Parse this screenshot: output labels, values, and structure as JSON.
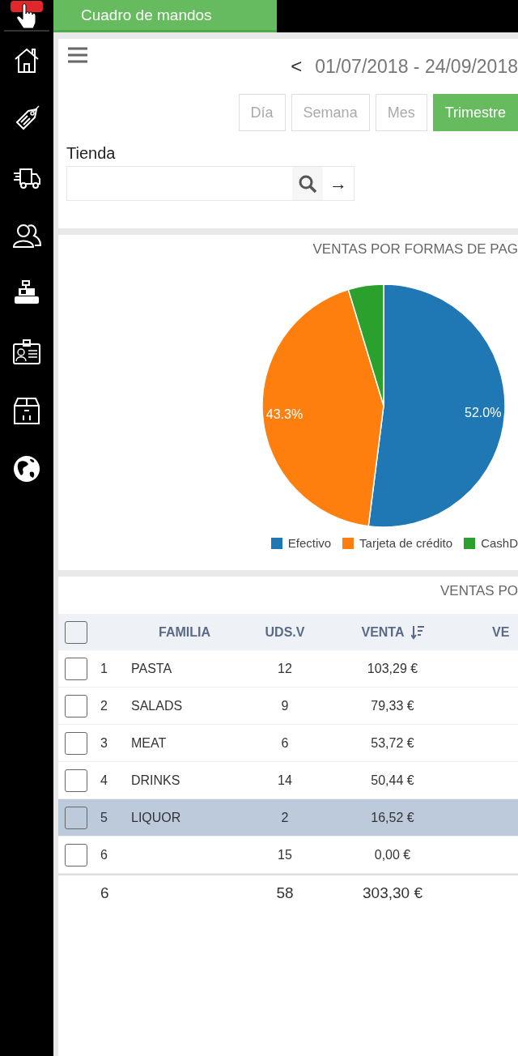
{
  "top_tab": {
    "label": "Cuadro de mandos",
    "selected": true
  },
  "filters": {
    "prev": "<",
    "date_range": "01/07/2018 - 24/09/2018",
    "periods": [
      {
        "label": "Día",
        "selected": false
      },
      {
        "label": "Semana",
        "selected": false
      },
      {
        "label": "Mes",
        "selected": false
      },
      {
        "label": "Trimestre",
        "selected": true
      }
    ],
    "store_label": "Tienda",
    "go": "→"
  },
  "payment_chart": {
    "title": "VENTAS POR FORMAS DE PAG",
    "chart_data": {
      "type": "pie",
      "categories": [
        "Efectivo",
        "Tarjeta de crédito",
        "CashD"
      ],
      "values": [
        52.0,
        43.3,
        4.7
      ],
      "colors": [
        "#1f77b4",
        "#ff7f0e",
        "#2ca02c"
      ],
      "value_labels": [
        "52.0%",
        "43.3%",
        null
      ]
    }
  },
  "family_table": {
    "title": "VENTAS PO",
    "columns": [
      "FAMILIA",
      "UDS.V",
      "VENTA",
      "VE"
    ],
    "header_checked": false,
    "rows": [
      {
        "index": "1",
        "familia": "PASTA",
        "uds": "12",
        "venta": "103,29 €",
        "checked": false,
        "selected": false
      },
      {
        "index": "2",
        "familia": "SALADS",
        "uds": "9",
        "venta": "79,33 €",
        "checked": false,
        "selected": false
      },
      {
        "index": "3",
        "familia": "MEAT",
        "uds": "6",
        "venta": "53,72 €",
        "checked": false,
        "selected": false
      },
      {
        "index": "4",
        "familia": "DRINKS",
        "uds": "14",
        "venta": "50,44 €",
        "checked": false,
        "selected": false
      },
      {
        "index": "5",
        "familia": "LIQUOR",
        "uds": "2",
        "venta": "16,52 €",
        "checked": false,
        "selected": true
      },
      {
        "index": "6",
        "uds": "15",
        "venta": "0,00 €",
        "checked": false,
        "selected": false
      }
    ],
    "totals": {
      "count": "6",
      "uds": "58",
      "venta": "303,30 €"
    }
  }
}
